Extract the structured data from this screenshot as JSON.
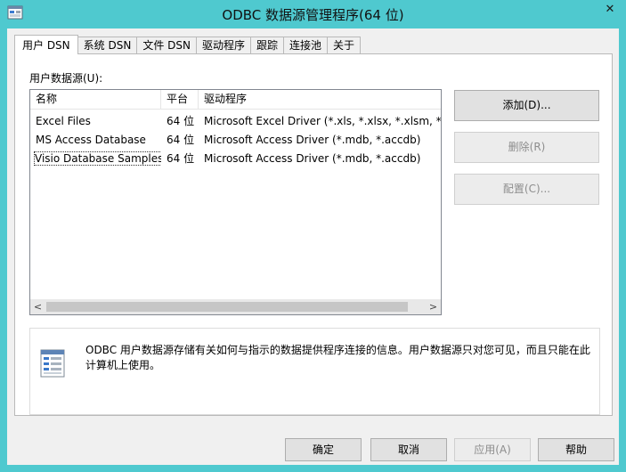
{
  "window": {
    "title": "ODBC 数据源管理程序(64 位)",
    "close_glyph": "✕"
  },
  "tabs": [
    {
      "label": "用户 DSN",
      "active": true
    },
    {
      "label": "系统 DSN",
      "active": false
    },
    {
      "label": "文件 DSN",
      "active": false
    },
    {
      "label": "驱动程序",
      "active": false
    },
    {
      "label": "跟踪",
      "active": false
    },
    {
      "label": "连接池",
      "active": false
    },
    {
      "label": "关于",
      "active": false
    }
  ],
  "user_dsn": {
    "list_label": "用户数据源(U):",
    "columns": [
      "名称",
      "平台",
      "驱动程序"
    ],
    "rows": [
      [
        "Excel Files",
        "64 位",
        "Microsoft Excel Driver (*.xls, *.xlsx, *.xlsm, *.xlsb)"
      ],
      [
        "MS Access Database",
        "64 位",
        "Microsoft Access Driver (*.mdb, *.accdb)"
      ],
      [
        "Visio Database Samples",
        "64 位",
        "Microsoft Access Driver (*.mdb, *.accdb)"
      ]
    ],
    "focused_row": 2,
    "scroll_left_glyph": "<",
    "scroll_right_glyph": ">",
    "buttons": {
      "add": "添加(D)...",
      "remove": "删除(R)",
      "configure": "配置(C)..."
    },
    "info_text": "ODBC 用户数据源存储有关如何与指示的数据提供程序连接的信息。用户数据源只对您可见，而且只能在此计算机上使用。"
  },
  "footer": {
    "ok": "确定",
    "cancel": "取消",
    "apply": "应用(A)",
    "help": "帮助"
  },
  "colors": {
    "window_frame": "#4fc9cf",
    "panel_bg": "#ffffff",
    "dialog_bg": "#f0f0f0"
  }
}
